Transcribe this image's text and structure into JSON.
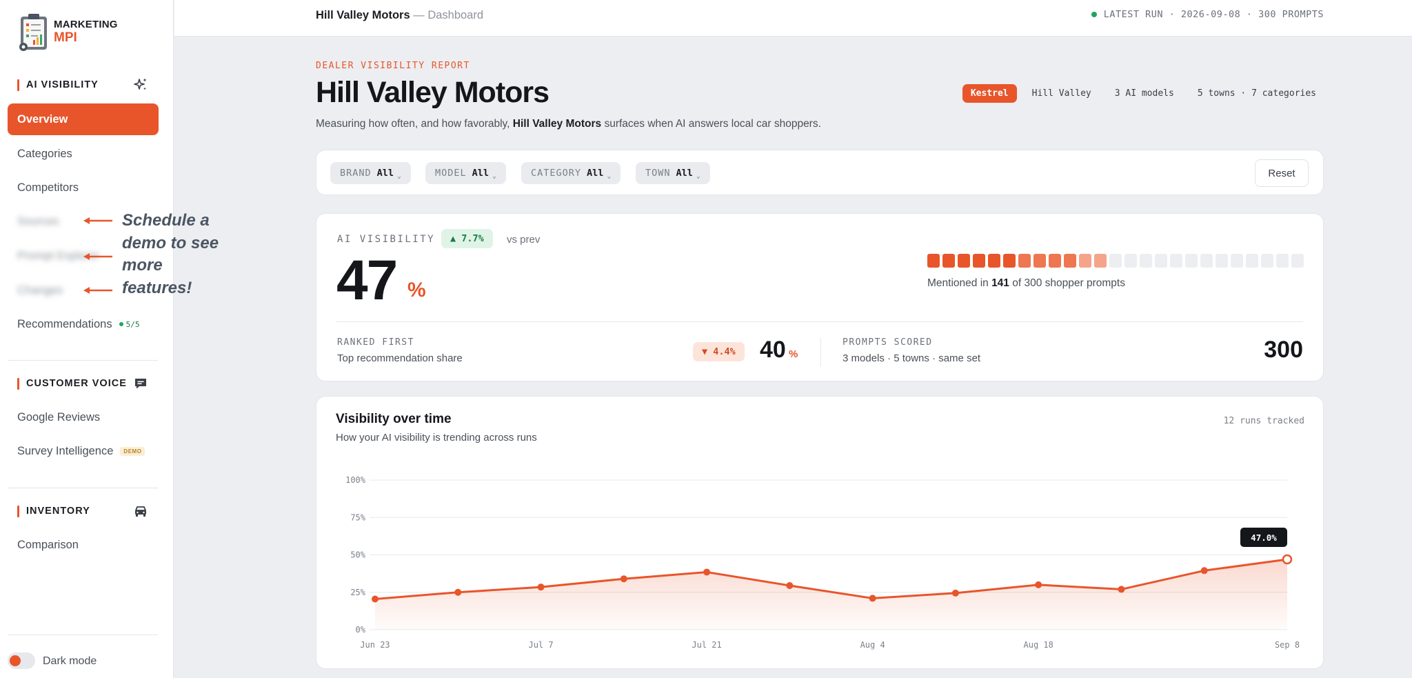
{
  "brand": {
    "line1": "MARKETING",
    "line2": "MPI"
  },
  "sidebar": {
    "sections": [
      {
        "title": "AI VISIBILITY",
        "icon": "sparkles-icon"
      },
      {
        "title": "CUSTOMER VOICE",
        "icon": "chat-icon"
      },
      {
        "title": "INVENTORY",
        "icon": "car-icon"
      }
    ],
    "items": [
      {
        "label": "Overview"
      },
      {
        "label": "Categories"
      },
      {
        "label": "Competitors"
      },
      {
        "label": "Sources"
      },
      {
        "label": "Prompt Explorer"
      },
      {
        "label": "Changes"
      },
      {
        "label": "Recommendations",
        "badge": "5/5"
      },
      {
        "label": "Google Reviews"
      },
      {
        "label": "Survey Intelligence",
        "badge": "DEMO"
      },
      {
        "label": "Comparison"
      }
    ],
    "callout": "Schedule a demo to see more features!",
    "dark_mode_label": "Dark mode"
  },
  "topbar": {
    "title": "Hill Valley Motors",
    "separator": "—",
    "page": "Dashboard",
    "latest_run": "LATEST RUN · 2026-09-08 · 300 PROMPTS"
  },
  "header": {
    "eyebrow": "DEALER VISIBILITY REPORT",
    "title": "Hill Valley Motors",
    "subtitle_pre": "Measuring how often, and how favorably, ",
    "subtitle_bold": "Hill Valley Motors",
    "subtitle_post": " surfaces when AI answers local car shoppers.",
    "pills": [
      "Kestrel",
      "Hill Valley",
      "3 AI models",
      "5 towns · 7 categories"
    ]
  },
  "filters": [
    {
      "key": "BRAND",
      "value": "All"
    },
    {
      "key": "MODEL",
      "value": "All"
    },
    {
      "key": "CATEGORY",
      "value": "All"
    },
    {
      "key": "TOWN",
      "value": "All"
    }
  ],
  "reset_label": "Reset",
  "metrics": {
    "label": "AI VISIBILITY",
    "delta": "▲ 7.7%",
    "vs": "vs prev",
    "value": "47",
    "unit": "%",
    "segments_total": 25,
    "segments_filled": 12,
    "mentioned_pre": "Mentioned in ",
    "mentioned_count": "141",
    "mentioned_post": " of 300 shopper prompts",
    "ranked_label": "RANKED FIRST",
    "ranked_sub": "Top recommendation share",
    "ranked_delta": "▼ 4.4%",
    "ranked_value": "40",
    "ranked_unit": "%",
    "prompts_label": "PROMPTS SCORED",
    "prompts_sub": "3 models · 5 towns · same set",
    "prompts_value": "300"
  },
  "chart": {
    "title": "Visibility over time",
    "subtitle": "How your AI visibility is trending across runs",
    "runs": "12 runs tracked",
    "tooltip": "47.0%"
  },
  "colors": {
    "accent": "#e8552b",
    "accent_light": "#f5a48a",
    "segment_empty": "#eceef1",
    "positive": "#1b7a45",
    "negative": "#d44a24"
  },
  "chart_data": {
    "type": "area",
    "title": "Visibility over time",
    "x": [
      "Jun 23",
      "Jun 30",
      "Jul 7",
      "Jul 14",
      "Jul 21",
      "Jul 28",
      "Aug 4",
      "Aug 11",
      "Aug 18",
      "Aug 25",
      "Sep 1",
      "Sep 8"
    ],
    "x_tick_labels": [
      "Jun 23",
      "Jul 7",
      "Jul 21",
      "Aug 4",
      "Aug 18",
      "Sep 8"
    ],
    "series": [
      {
        "values": [
          20.5,
          25,
          28.5,
          34,
          38.5,
          29.5,
          21,
          24.5,
          30,
          27,
          39.5,
          47
        ]
      }
    ],
    "y_ticks": [
      "0%",
      "25%",
      "50%",
      "75%",
      "100%"
    ],
    "ylim": [
      0,
      100
    ],
    "grid": true
  }
}
